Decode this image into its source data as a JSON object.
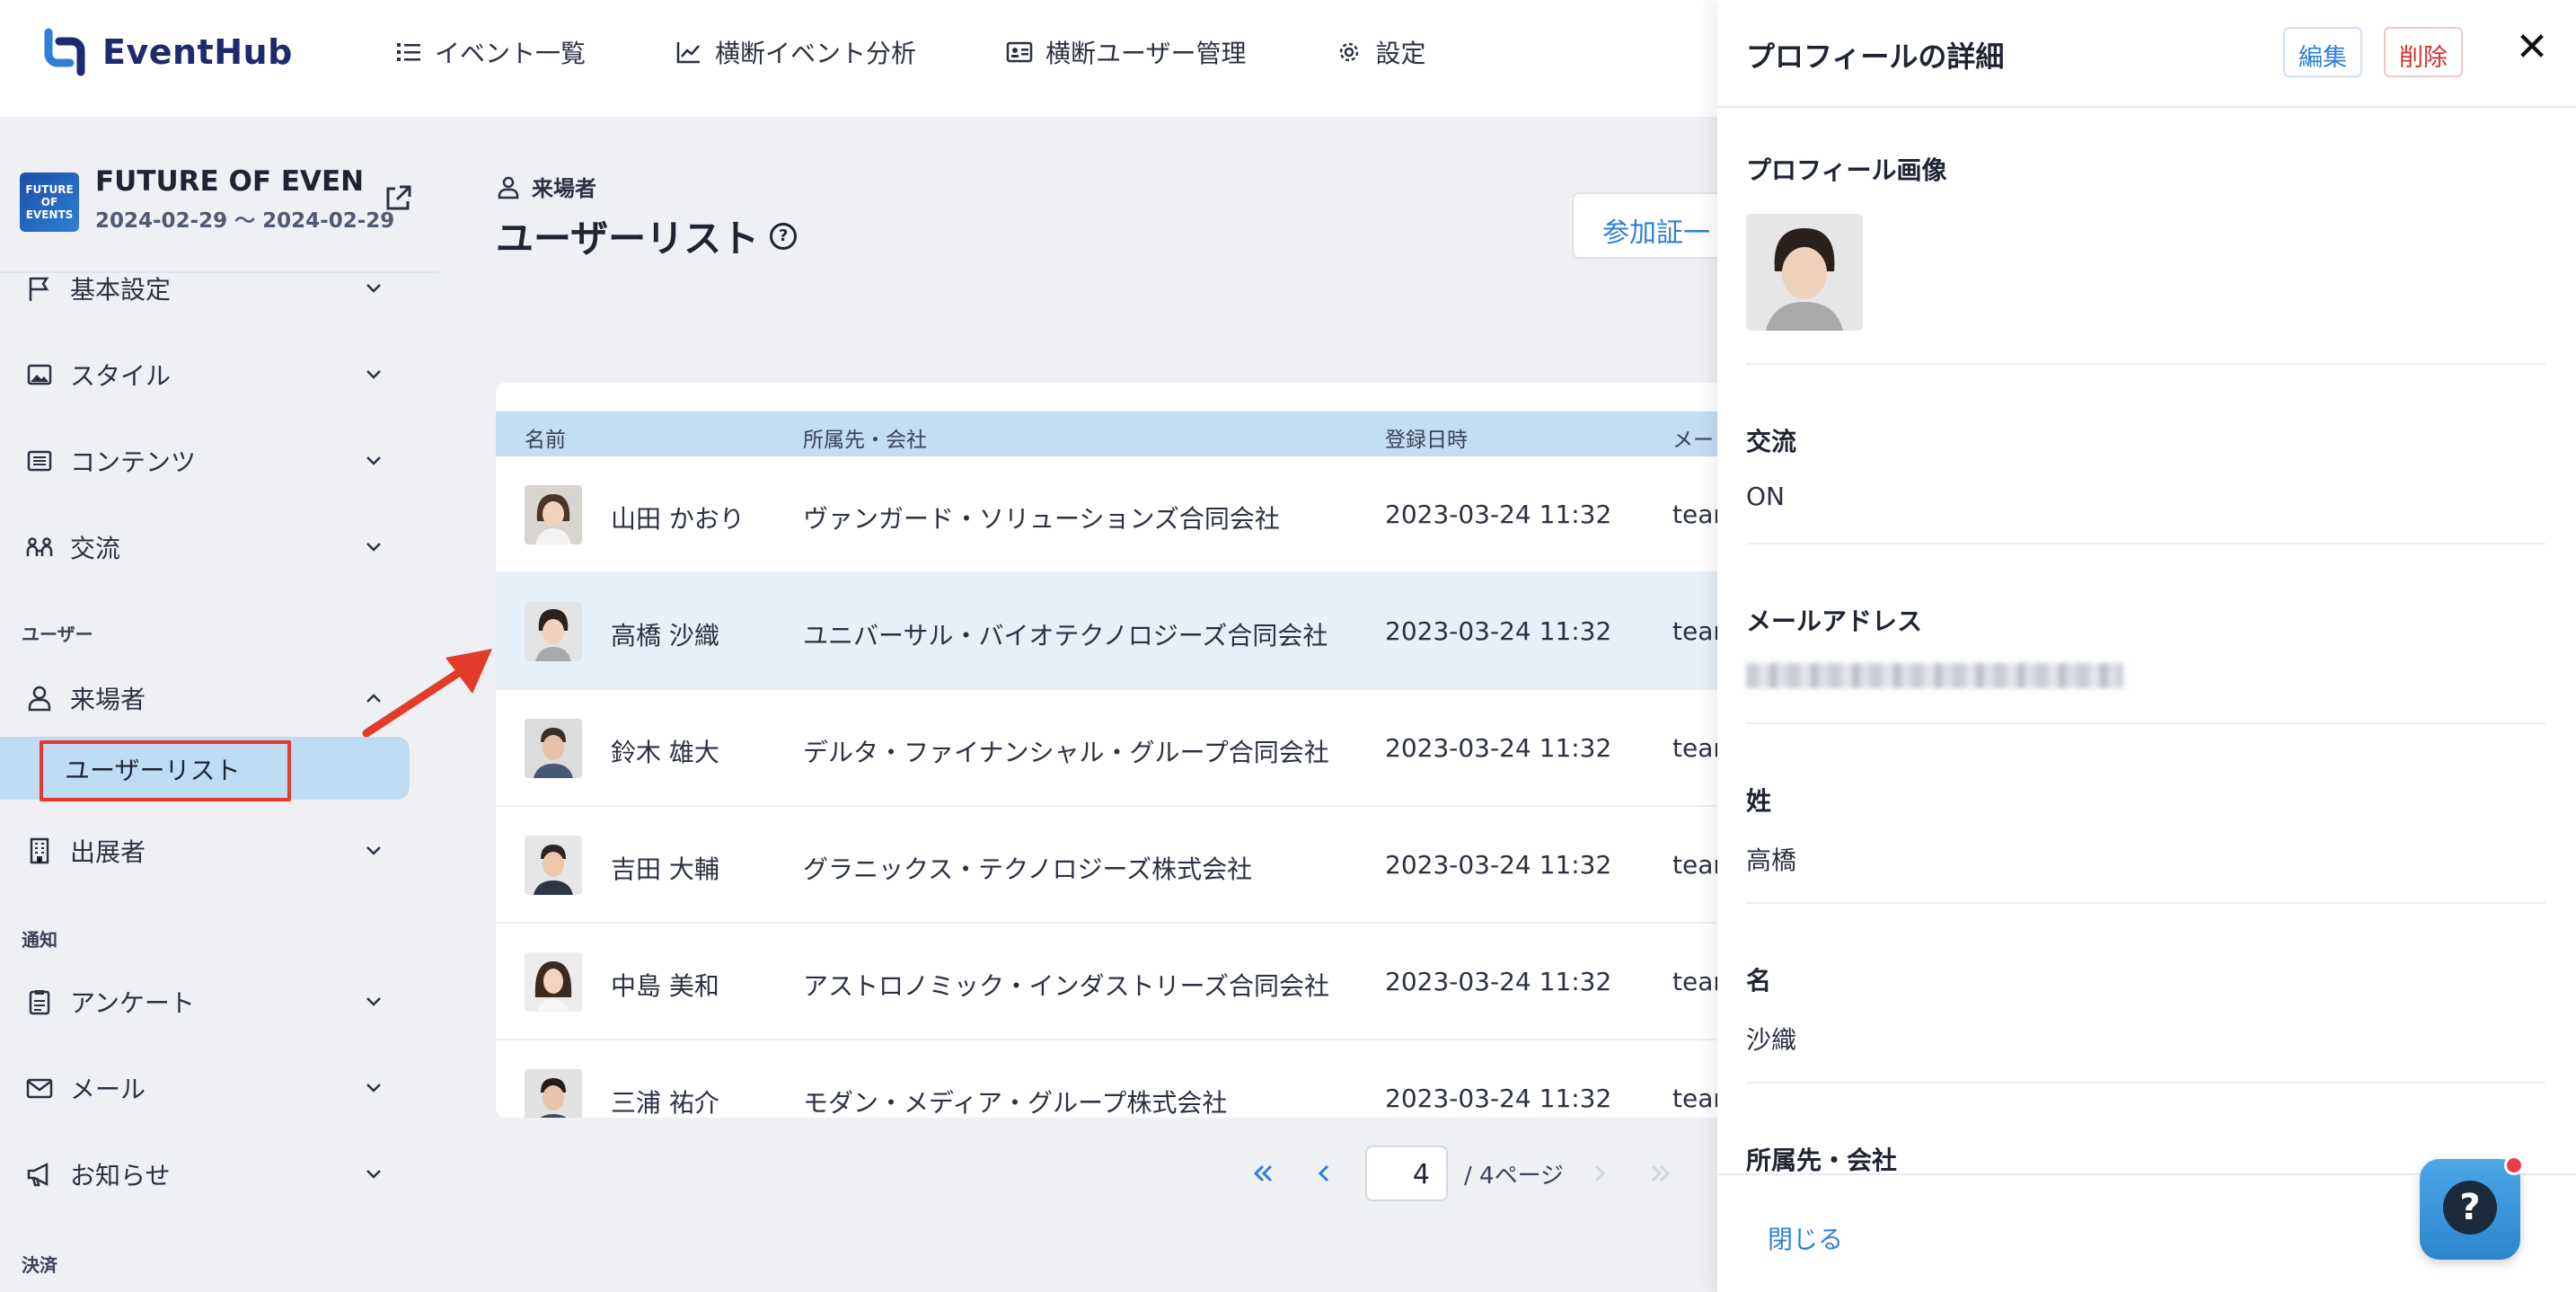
{
  "app": {
    "name": "EventHub"
  },
  "nav": [
    {
      "label": "イベント一覧",
      "icon": "list-icon"
    },
    {
      "label": "横断イベント分析",
      "icon": "chart-line-icon"
    },
    {
      "label": "横断ユーザー管理",
      "icon": "id-card-icon"
    },
    {
      "label": "設定",
      "icon": "gear-icon"
    }
  ],
  "event": {
    "title": "FUTURE OF EVEN…",
    "dates": "2024-02-29 〜 2024-02-29",
    "thumb_text": "FUTURE OF EVENTS"
  },
  "sidebar": {
    "items": [
      {
        "label": "基本設定",
        "icon": "flag-icon"
      },
      {
        "label": "スタイル",
        "icon": "image-icon"
      },
      {
        "label": "コンテンツ",
        "icon": "list-alt-icon"
      },
      {
        "label": "交流",
        "icon": "people-link-icon"
      }
    ],
    "section_user": "ユーザー",
    "visitor": {
      "label": "来場者",
      "icon": "person-icon"
    },
    "user_list": "ユーザーリスト",
    "exhibitor": {
      "label": "出展者",
      "icon": "building-icon"
    },
    "section_notify": "通知",
    "notify_items": [
      {
        "label": "アンケート",
        "icon": "clipboard-icon"
      },
      {
        "label": "メール",
        "icon": "mail-icon"
      },
      {
        "label": "お知らせ",
        "icon": "megaphone-icon"
      }
    ],
    "section_payment": "決済"
  },
  "main": {
    "crumb": "来場者",
    "title": "ユーザーリスト",
    "badge_button": "参加証一",
    "columns": [
      "名前",
      "所属先・会社",
      "登録日時",
      "メー"
    ],
    "rows": [
      {
        "name": "山田 かおり",
        "company": "ヴァンガード・ソリューションズ合同会社",
        "date": "2023-03-24 11:32",
        "mail": "tean",
        "selected": false
      },
      {
        "name": "高橋 沙織",
        "company": "ユニバーサル・バイオテクノロジーズ合同会社",
        "date": "2023-03-24 11:32",
        "mail": "tean",
        "selected": true
      },
      {
        "name": "鈴木 雄大",
        "company": "デルタ・ファイナンシャル・グループ合同会社",
        "date": "2023-03-24 11:32",
        "mail": "tean",
        "selected": false
      },
      {
        "name": "吉田 大輔",
        "company": "グラニックス・テクノロジーズ株式会社",
        "date": "2023-03-24 11:32",
        "mail": "tean",
        "selected": false
      },
      {
        "name": "中島 美和",
        "company": "アストロノミック・インダストリーズ合同会社",
        "date": "2023-03-24 11:32",
        "mail": "tean",
        "selected": false
      },
      {
        "name": "三浦 祐介",
        "company": "モダン・メディア・グループ株式会社",
        "date": "2023-03-24 11:32",
        "mail": "tean",
        "selected": false
      }
    ],
    "pager": {
      "current": "4",
      "total": "/ 4ページ"
    }
  },
  "panel": {
    "title": "プロフィールの詳細",
    "edit": "編集",
    "delete": "削除",
    "close_x": "✕",
    "fields": {
      "image_label": "プロフィール画像",
      "exchange_label": "交流",
      "exchange_value": "ON",
      "email_label": "メールアドレス",
      "last_name_label": "姓",
      "last_name_value": "高橋",
      "first_name_label": "名",
      "first_name_value": "沙織",
      "company_label": "所属先・会社"
    },
    "footer_close": "閉じる"
  },
  "help": {
    "symbol": "?"
  },
  "colors": {
    "accent": "#2f7fd8",
    "danger": "#d6302a",
    "selected_row": "#e5f0fa",
    "header_row": "#c3ddf3",
    "annotation": "#e23b2a"
  }
}
